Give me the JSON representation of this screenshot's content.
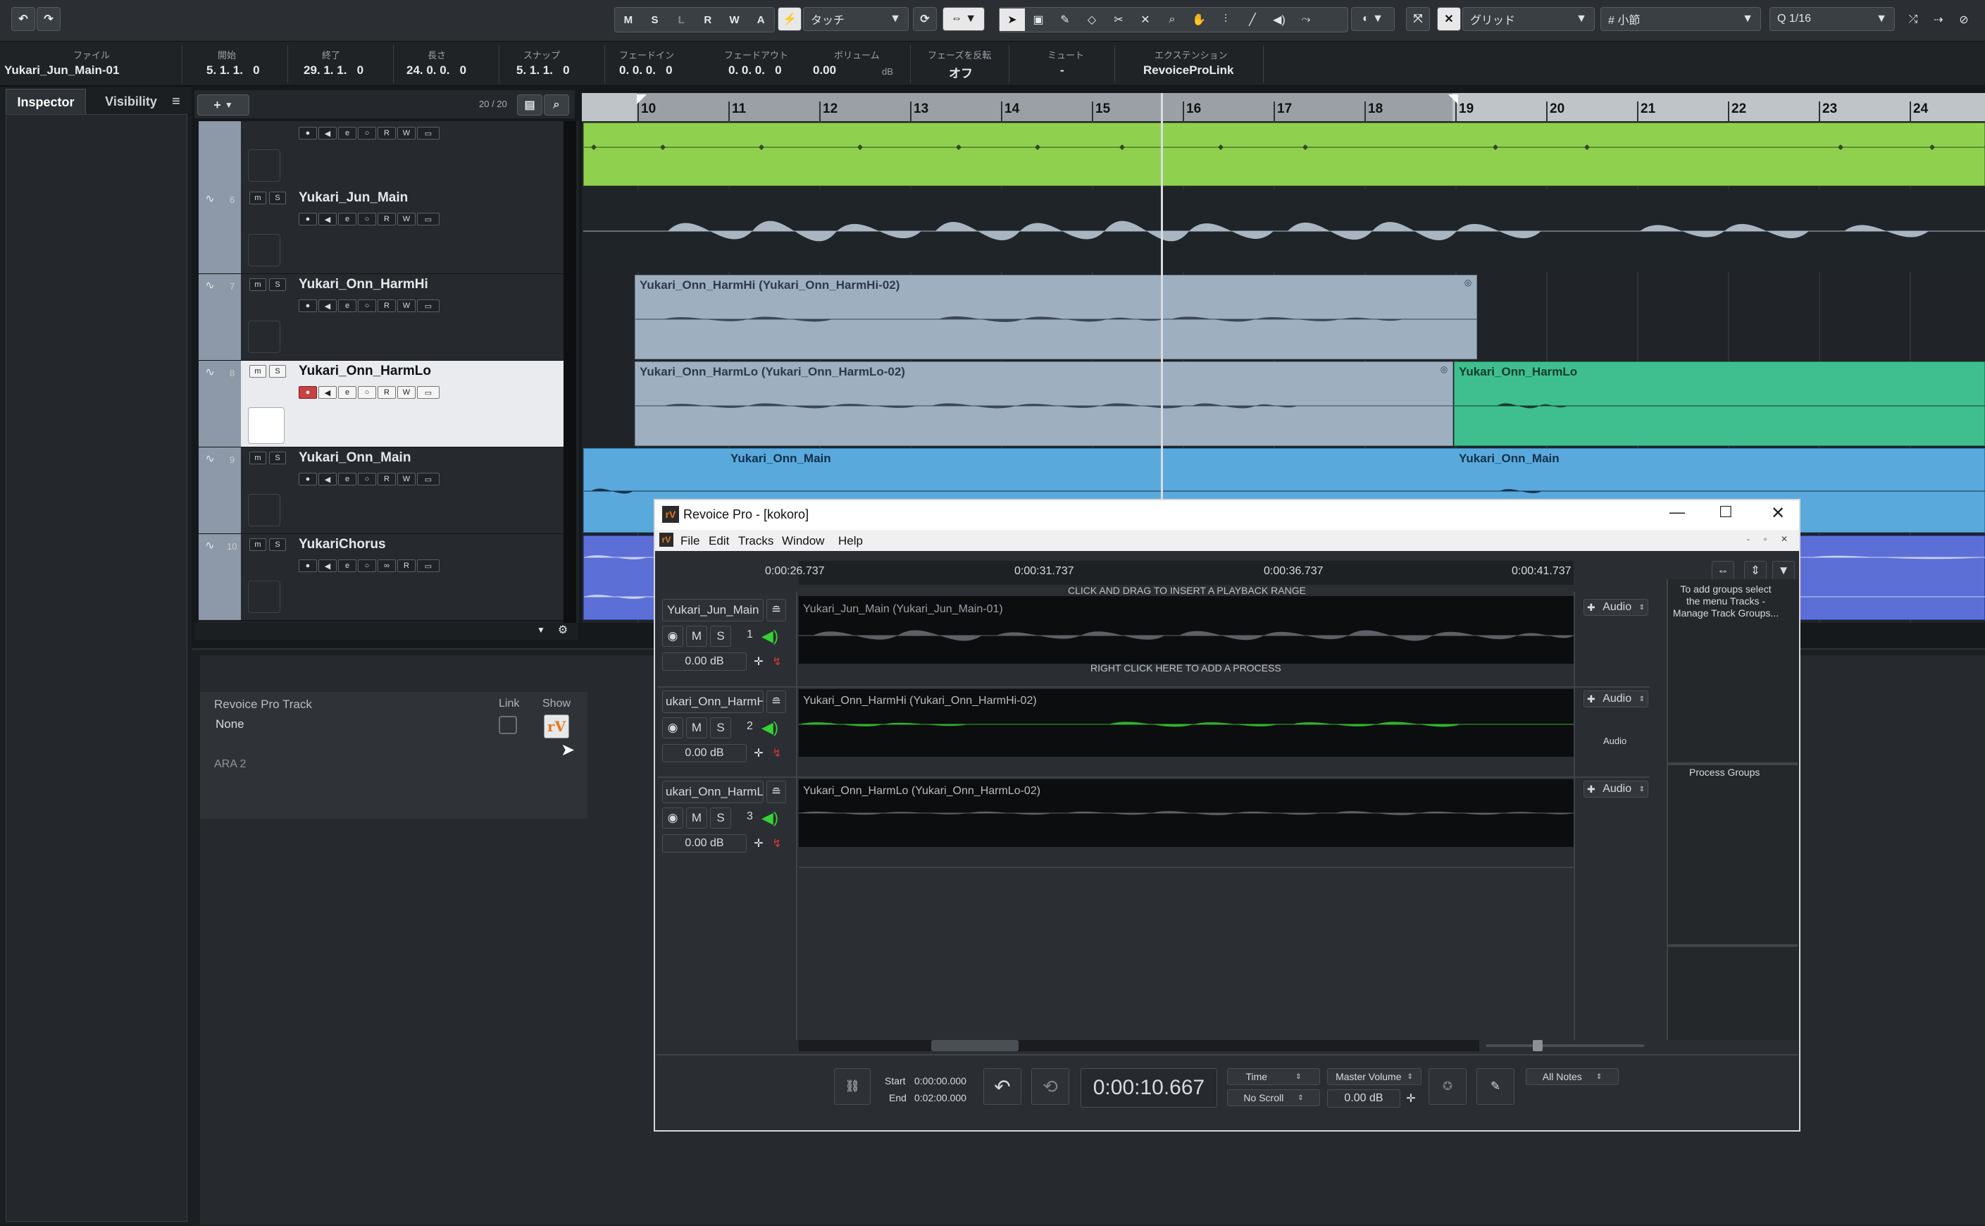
{
  "toolbar": {
    "undo_icon": "undo-icon",
    "redo_icon": "redo-icon",
    "mode_buttons": [
      "M",
      "S",
      "L",
      "R",
      "W",
      "A"
    ],
    "automation_mode": "タッチ",
    "grid_type": "グリッド",
    "grid_unit": "小節",
    "quantize": "1/16"
  },
  "infoline": {
    "fields": [
      {
        "label": "ファイル",
        "value": "Yukari_Jun_Main-01"
      },
      {
        "label": "開始",
        "value": "5. 1. 1.   0"
      },
      {
        "label": "終了",
        "value": "29. 1. 1.   0"
      },
      {
        "label": "長さ",
        "value": "24. 0. 0.   0"
      },
      {
        "label": "スナップ",
        "value": "5. 1. 1.   0"
      },
      {
        "label": "フェードイン",
        "value": "0. 0. 0.   0"
      },
      {
        "label": "フェードアウト",
        "value": "0. 0. 0.   0"
      },
      {
        "label": "ボリューム",
        "value": "0.00"
      },
      {
        "label": "フェーズを反転",
        "value": "オフ"
      },
      {
        "label": "ミュート",
        "value": "-"
      },
      {
        "label": "エクステンション",
        "value": "RevoiceProLink"
      }
    ],
    "volume_unit": "dB"
  },
  "left_tabs": {
    "inspector": "Inspector",
    "visibility": "Visibility"
  },
  "tracklist": {
    "count": "20 / 20",
    "tracks": [
      {
        "num": "6",
        "name": "Yukari_Jun_Main"
      },
      {
        "num": "7",
        "name": "Yukari_Onn_HarmHi"
      },
      {
        "num": "8",
        "name": "Yukari_Onn_HarmLo"
      },
      {
        "num": "9",
        "name": "Yukari_Onn_Main"
      },
      {
        "num": "10",
        "name": "YukariChorus"
      }
    ],
    "m_label": "m",
    "s_label": "S",
    "r_label": "R",
    "w_label": "W"
  },
  "ruler": {
    "bars": [
      "10",
      "11",
      "12",
      "13",
      "14",
      "15",
      "16",
      "17",
      "18",
      "19",
      "20",
      "21",
      "22",
      "23",
      "24"
    ]
  },
  "clips": {
    "harmhi": "Yukari_Onn_HarmHi (Yukari_Onn_HarmHi-02)",
    "harmlo": "Yukari_Onn_HarmLo (Yukari_Onn_HarmLo-02)",
    "harmlo2": "Yukari_Onn_HarmLo",
    "main1": "Yukari_Onn_Main",
    "main2": "Yukari_Onn_Main"
  },
  "lower_zone": {
    "title": "Revoice Pro Track",
    "value": "None",
    "link_label": "Link",
    "show_label": "Show",
    "ara": "ARA 2"
  },
  "revoice": {
    "title": "Revoice Pro - [kokoro]",
    "menu": [
      "File",
      "Edit",
      "Tracks",
      "Window",
      "Help"
    ],
    "timeline": [
      "0:00:26.737",
      "0:00:31.737",
      "0:00:36.737",
      "0:00:41.737"
    ],
    "hint_top": "CLICK AND DRAG TO INSERT A PLAYBACK RANGE",
    "hint_bottom": "RIGHT CLICK HERE TO ADD A PROCESS",
    "tracks": [
      {
        "name": "Yukari_Jun_Main",
        "num": "1",
        "gain": "0.00 dB",
        "clip": "Yukari_Jun_Main (Yukari_Jun_Main-01)",
        "type": "Audio"
      },
      {
        "name": "ukari_Onn_HarmH",
        "num": "2",
        "gain": "0.00 dB",
        "clip": "Yukari_Onn_HarmHi (Yukari_Onn_HarmHi-02)",
        "type": "Audio"
      },
      {
        "name": "ukari_Onn_HarmL",
        "num": "3",
        "gain": "0.00 dB",
        "clip": "Yukari_Onn_HarmLo (Yukari_Onn_HarmLo-02)",
        "type": "Audio"
      }
    ],
    "group_hint": "To add groups select the menu Tracks - Manage Track Groups...",
    "audio_label": "Audio",
    "process_groups": "Process Groups",
    "m": "M",
    "s": "S",
    "transport": {
      "start_label": "Start",
      "start": "0:00:00.000",
      "end_label": "End",
      "end": "0:02:00.000",
      "time": "0:00:10.667",
      "time_mode": "Time",
      "scroll": "No Scroll",
      "master": "Master Volume",
      "master_db": "0.00 dB",
      "notes": "All Notes"
    }
  },
  "colors": {
    "green": "#8fd14f",
    "blue": "#5aa9dc",
    "teal": "#3fbf8f",
    "gray_clip": "#9fb0bf",
    "chorus": "#5c6fd6"
  }
}
